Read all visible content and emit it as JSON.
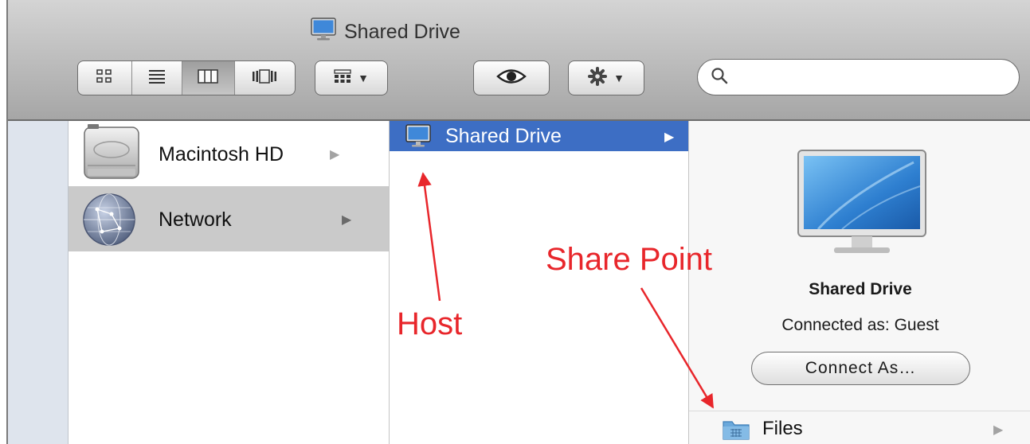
{
  "window": {
    "title": "Shared Drive",
    "title_icon": "computer-monitor-icon"
  },
  "toolbar": {
    "view_modes": [
      {
        "name": "icon-view",
        "icon": "icon-grid-icon",
        "active": false
      },
      {
        "name": "list-view",
        "icon": "list-lines-icon",
        "active": false
      },
      {
        "name": "column-view",
        "icon": "columns-icon",
        "active": true
      },
      {
        "name": "cover-flow-view",
        "icon": "cover-flow-icon",
        "active": false
      }
    ],
    "arrange_icon": "arrange-grid-icon",
    "quick_look_icon": "eye-icon",
    "action_icon": "gear-icon",
    "dropdown_icon": "triangle-down-icon",
    "search": {
      "value": "",
      "placeholder": "",
      "icon": "magnifier-icon"
    }
  },
  "columns": {
    "col1": {
      "items": [
        {
          "label": "Macintosh HD",
          "icon": "hard-drive-icon",
          "selected": false
        },
        {
          "label": "Network",
          "icon": "network-globe-icon",
          "selected": true
        }
      ]
    },
    "col2": {
      "items": [
        {
          "label": "Shared Drive",
          "icon": "computer-monitor-icon",
          "selected": true
        }
      ]
    },
    "col3": {
      "preview": {
        "name": "Shared Drive",
        "status": "Connected as: Guest",
        "connect_button": "Connect As…"
      },
      "items": [
        {
          "label": "Files",
          "icon": "shared-folder-icon"
        }
      ]
    }
  },
  "annotations": {
    "host": "Host",
    "share_point": "Share Point",
    "color": "#e8262b"
  },
  "colors": {
    "selection": "#3d6ec4",
    "inactive_selection": "#cacaca",
    "sidebar": "#dee4ed"
  }
}
